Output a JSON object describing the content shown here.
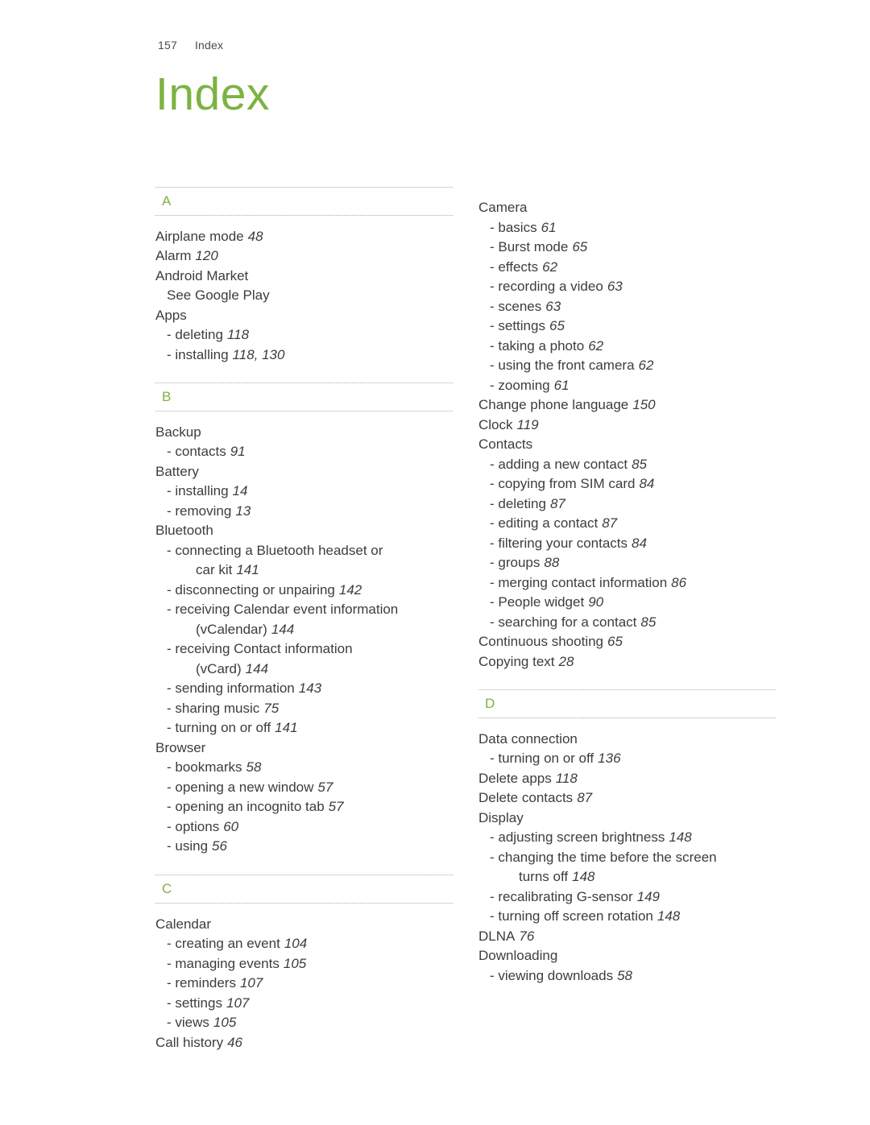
{
  "header": {
    "page_number": "157",
    "label": "Index"
  },
  "title": "Index",
  "accent_color": "#7cb342",
  "columns": [
    {
      "sections": [
        {
          "letter": "A",
          "entries": [
            {
              "level": 0,
              "text": "Airplane mode",
              "page": "48"
            },
            {
              "level": 0,
              "text": "Alarm",
              "page": "120"
            },
            {
              "level": 0,
              "text": "Android Market",
              "page": ""
            },
            {
              "level": 9,
              "text": "See Google Play",
              "page": ""
            },
            {
              "level": 0,
              "text": "Apps",
              "page": ""
            },
            {
              "level": 1,
              "text": "- deleting",
              "page": "118"
            },
            {
              "level": 1,
              "text": "- installing",
              "page": "118, 130"
            }
          ]
        },
        {
          "letter": "B",
          "entries": [
            {
              "level": 0,
              "text": "Backup",
              "page": ""
            },
            {
              "level": 1,
              "text": "- contacts",
              "page": "91"
            },
            {
              "level": 0,
              "text": "Battery",
              "page": ""
            },
            {
              "level": 1,
              "text": "- installing",
              "page": "14"
            },
            {
              "level": 1,
              "text": "- removing",
              "page": "13"
            },
            {
              "level": 0,
              "text": "Bluetooth",
              "page": ""
            },
            {
              "level": 1,
              "text": "- connecting a Bluetooth headset or",
              "page": ""
            },
            {
              "level": 2,
              "text": "car kit",
              "page": "141"
            },
            {
              "level": 1,
              "text": "- disconnecting or unpairing",
              "page": "142"
            },
            {
              "level": 1,
              "text": "- receiving Calendar event information",
              "page": ""
            },
            {
              "level": 2,
              "text": "(vCalendar)",
              "page": "144"
            },
            {
              "level": 1,
              "text": "- receiving Contact information",
              "page": ""
            },
            {
              "level": 2,
              "text": "(vCard)",
              "page": "144"
            },
            {
              "level": 1,
              "text": "- sending information",
              "page": "143"
            },
            {
              "level": 1,
              "text": "- sharing music",
              "page": "75"
            },
            {
              "level": 1,
              "text": "- turning on or off",
              "page": "141"
            },
            {
              "level": 0,
              "text": "Browser",
              "page": ""
            },
            {
              "level": 1,
              "text": "- bookmarks",
              "page": "58"
            },
            {
              "level": 1,
              "text": "- opening a new window",
              "page": "57"
            },
            {
              "level": 1,
              "text": "- opening an incognito tab",
              "page": "57"
            },
            {
              "level": 1,
              "text": "- options",
              "page": "60"
            },
            {
              "level": 1,
              "text": "- using",
              "page": "56"
            }
          ]
        },
        {
          "letter": "C",
          "entries": [
            {
              "level": 0,
              "text": "Calendar",
              "page": ""
            },
            {
              "level": 1,
              "text": "- creating an event",
              "page": "104"
            },
            {
              "level": 1,
              "text": "- managing events",
              "page": "105"
            },
            {
              "level": 1,
              "text": "- reminders",
              "page": "107"
            },
            {
              "level": 1,
              "text": "- settings",
              "page": "107"
            },
            {
              "level": 1,
              "text": "- views",
              "page": "105"
            },
            {
              "level": 0,
              "text": "Call history",
              "page": "46"
            }
          ]
        }
      ]
    },
    {
      "sections": [
        {
          "letter": "",
          "entries": [
            {
              "level": 0,
              "text": "Camera",
              "page": ""
            },
            {
              "level": 1,
              "text": "- basics",
              "page": "61"
            },
            {
              "level": 1,
              "text": "- Burst mode",
              "page": "65"
            },
            {
              "level": 1,
              "text": "- effects",
              "page": "62"
            },
            {
              "level": 1,
              "text": "- recording a video",
              "page": "63"
            },
            {
              "level": 1,
              "text": "- scenes",
              "page": "63"
            },
            {
              "level": 1,
              "text": "- settings",
              "page": "65"
            },
            {
              "level": 1,
              "text": "- taking a photo",
              "page": "62"
            },
            {
              "level": 1,
              "text": "- using the front camera",
              "page": "62"
            },
            {
              "level": 1,
              "text": "- zooming",
              "page": "61"
            },
            {
              "level": 0,
              "text": "Change phone language",
              "page": "150"
            },
            {
              "level": 0,
              "text": "Clock",
              "page": "119"
            },
            {
              "level": 0,
              "text": "Contacts",
              "page": ""
            },
            {
              "level": 1,
              "text": "- adding a new contact",
              "page": "85"
            },
            {
              "level": 1,
              "text": "- copying from SIM card",
              "page": "84"
            },
            {
              "level": 1,
              "text": "- deleting",
              "page": "87"
            },
            {
              "level": 1,
              "text": "- editing a contact",
              "page": "87"
            },
            {
              "level": 1,
              "text": "- filtering your contacts",
              "page": "84"
            },
            {
              "level": 1,
              "text": "- groups",
              "page": "88"
            },
            {
              "level": 1,
              "text": "- merging contact information",
              "page": "86"
            },
            {
              "level": 1,
              "text": "- People widget",
              "page": "90"
            },
            {
              "level": 1,
              "text": "- searching for a contact",
              "page": "85"
            },
            {
              "level": 0,
              "text": "Continuous shooting",
              "page": "65"
            },
            {
              "level": 0,
              "text": "Copying text",
              "page": "28"
            }
          ]
        },
        {
          "letter": "D",
          "entries": [
            {
              "level": 0,
              "text": "Data connection",
              "page": ""
            },
            {
              "level": 1,
              "text": "- turning on or off",
              "page": "136"
            },
            {
              "level": 0,
              "text": "Delete apps",
              "page": "118"
            },
            {
              "level": 0,
              "text": "Delete contacts",
              "page": "87"
            },
            {
              "level": 0,
              "text": "Display",
              "page": ""
            },
            {
              "level": 1,
              "text": "- adjusting screen brightness",
              "page": "148"
            },
            {
              "level": 1,
              "text": "- changing the time before the screen",
              "page": ""
            },
            {
              "level": 2,
              "text": "turns off",
              "page": "148"
            },
            {
              "level": 1,
              "text": "- recalibrating G-sensor",
              "page": "149"
            },
            {
              "level": 1,
              "text": "- turning off screen rotation",
              "page": "148"
            },
            {
              "level": 0,
              "text": "DLNA",
              "page": "76"
            },
            {
              "level": 0,
              "text": "Downloading",
              "page": ""
            },
            {
              "level": 1,
              "text": "- viewing downloads",
              "page": "58"
            }
          ]
        }
      ]
    }
  ]
}
